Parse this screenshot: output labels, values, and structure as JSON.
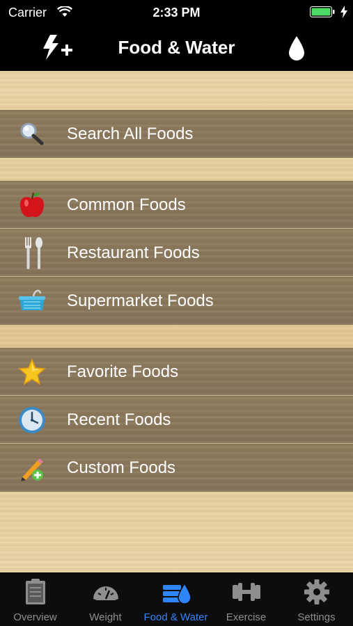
{
  "status": {
    "carrier": "Carrier",
    "time": "2:33 PM"
  },
  "nav": {
    "title": "Food & Water",
    "left_icon": "flash-plus-icon",
    "right_icon": "water-drop-icon"
  },
  "groups": [
    {
      "items": [
        {
          "label": "Search All Foods",
          "icon": "magnifier-icon"
        }
      ]
    },
    {
      "items": [
        {
          "label": "Common Foods",
          "icon": "apple-icon"
        },
        {
          "label": "Restaurant Foods",
          "icon": "fork-spoon-icon"
        },
        {
          "label": "Supermarket Foods",
          "icon": "basket-icon"
        }
      ]
    },
    {
      "items": [
        {
          "label": "Favorite Foods",
          "icon": "star-icon"
        },
        {
          "label": "Recent Foods",
          "icon": "clock-icon"
        },
        {
          "label": "Custom Foods",
          "icon": "pencil-plus-icon"
        }
      ]
    }
  ],
  "tabs": [
    {
      "label": "Overview",
      "icon": "clipboard-icon",
      "active": false
    },
    {
      "label": "Weight",
      "icon": "scale-icon",
      "active": false
    },
    {
      "label": "Food & Water",
      "icon": "food-water-icon",
      "active": true
    },
    {
      "label": "Exercise",
      "icon": "dumbbell-icon",
      "active": false
    },
    {
      "label": "Settings",
      "icon": "gear-icon",
      "active": false
    }
  ],
  "colors": {
    "accent": "#2e86ff",
    "battery": "#4cd964",
    "row": "#8a775a",
    "wood": "#e8cf9f"
  }
}
